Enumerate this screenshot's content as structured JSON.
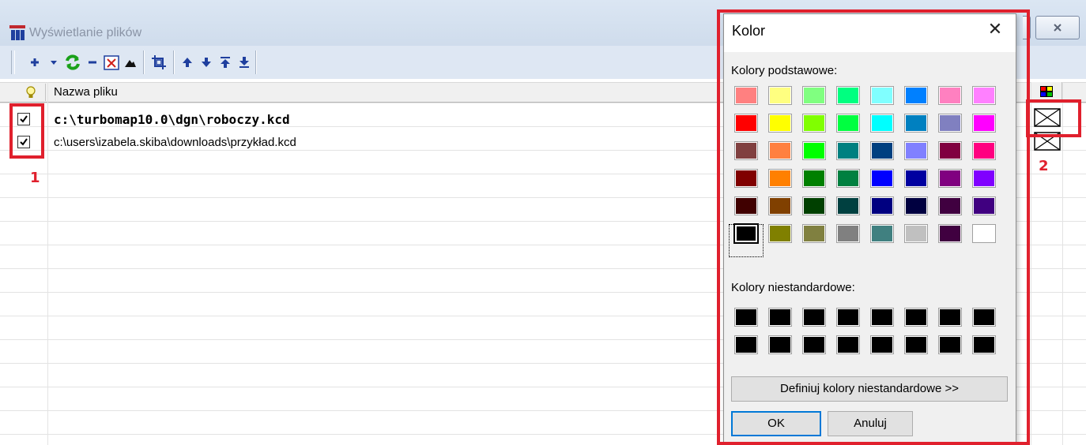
{
  "window": {
    "title": "Wyświetlanie plików",
    "close_glyph": "🗙",
    "controls": [
      "maximize-button",
      "close-button"
    ]
  },
  "toolbar": {
    "buttons": [
      {
        "name": "add-icon",
        "color": "#1f3f9e"
      },
      {
        "name": "dropdown-arrow-icon",
        "color": "#1f3f9e"
      },
      {
        "name": "refresh-icon",
        "color": "#1aa11a"
      },
      {
        "name": "remove-icon",
        "color": "#1f3f9e"
      },
      {
        "name": "clear-icon",
        "color": "#d0201a"
      },
      {
        "name": "mountain-icon",
        "color": "#111111"
      },
      {
        "name": "crop-frame-icon",
        "color": "#1f3f9e"
      },
      {
        "name": "move-up-icon",
        "color": "#1f3f9e"
      },
      {
        "name": "move-down-icon",
        "color": "#1f3f9e"
      },
      {
        "name": "move-top-icon",
        "color": "#1f3f9e"
      },
      {
        "name": "move-bottom-icon",
        "color": "#1f3f9e"
      }
    ]
  },
  "grid": {
    "header": {
      "visibility_icon": "lightbulb-icon",
      "name_column": "Nazwa pliku",
      "color_icon": "palette-icon"
    },
    "rows": [
      {
        "checked": true,
        "file": "c:\\turbomap10.0\\dgn\\roboczy.kcd",
        "bold": true
      },
      {
        "checked": true,
        "file": "c:\\users\\izabela.skiba\\downloads\\przykład.kcd",
        "bold": false
      }
    ]
  },
  "annotations": {
    "label_1": "1",
    "label_2": "2",
    "color": "#e0202d"
  },
  "dialog": {
    "title": "Kolor",
    "close_glyph": "✕",
    "basic_label": "Kolory podstawowe:",
    "custom_label": "Kolory niestandardowe:",
    "define_button": "Definiuj kolory niestandardowe >>",
    "ok_button": "OK",
    "cancel_button": "Anuluj",
    "basic_colors": [
      [
        "#ff8080",
        "#ffff80",
        "#80ff80",
        "#00ff80",
        "#80ffff",
        "#0080ff",
        "#ff80c0",
        "#ff80ff"
      ],
      [
        "#ff0000",
        "#ffff00",
        "#80ff00",
        "#00ff40",
        "#00ffff",
        "#0080c0",
        "#8080c0",
        "#ff00ff"
      ],
      [
        "#804040",
        "#ff8040",
        "#00ff00",
        "#008080",
        "#004080",
        "#8080ff",
        "#800040",
        "#ff0080"
      ],
      [
        "#800000",
        "#ff8000",
        "#008000",
        "#008040",
        "#0000ff",
        "#0000a0",
        "#800080",
        "#8000ff"
      ],
      [
        "#400000",
        "#804000",
        "#004000",
        "#004040",
        "#000080",
        "#000040",
        "#400040",
        "#400080"
      ],
      [
        "#000000",
        "#808000",
        "#808040",
        "#808080",
        "#408080",
        "#c0c0c0",
        "#400040",
        "#ffffff"
      ]
    ],
    "selected_color": "#000000",
    "custom_colors": [
      [
        "#000000",
        "#000000",
        "#000000",
        "#000000",
        "#000000",
        "#000000",
        "#000000",
        "#000000"
      ],
      [
        "#000000",
        "#000000",
        "#000000",
        "#000000",
        "#000000",
        "#000000",
        "#000000",
        "#000000"
      ]
    ]
  }
}
